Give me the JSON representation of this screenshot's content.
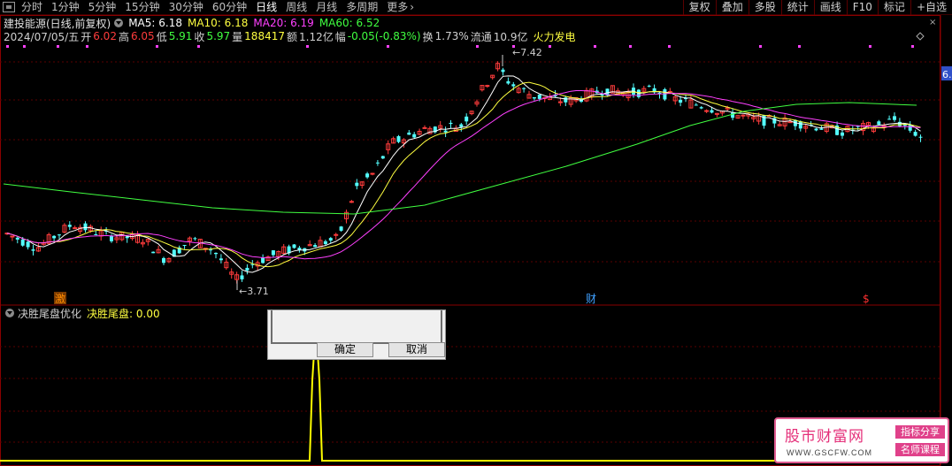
{
  "toolbar": {
    "periods": [
      "分时",
      "1分钟",
      "5分钟",
      "15分钟",
      "30分钟",
      "60分钟",
      "日线",
      "周线",
      "月线",
      "多周期",
      "更多"
    ],
    "active_period": "日线",
    "more_chevron": "›",
    "right_buttons": [
      "复权",
      "叠加",
      "多股",
      "统计",
      "画线",
      "F10",
      "标记",
      "+自选"
    ]
  },
  "stock": {
    "name": "建投能源(日线,前复权)",
    "ma": [
      {
        "label": "MA5: 6.18",
        "color": "#ffffff"
      },
      {
        "label": "MA10: 6.18",
        "color": "#ffff40"
      },
      {
        "label": "MA20: 6.19",
        "color": "#ff40ff"
      },
      {
        "label": "MA60: 6.52",
        "color": "#40ff40"
      }
    ]
  },
  "quote": {
    "date": "2024/07/05/五",
    "open_label": "开",
    "open": "6.02",
    "high_label": "高",
    "high": "6.05",
    "low_label": "低",
    "low": "5.91",
    "close_label": "收",
    "close": "5.97",
    "volume_label": "量",
    "volume": "188417",
    "amount_label": "额",
    "amount": "1.12亿",
    "change_label": "幅",
    "change": "-0.05(-0.83%)",
    "turnover_label": "换",
    "turnover": "1.73%",
    "float_label": "流通",
    "float": "10.9亿",
    "sector": "火力发电"
  },
  "annotations": {
    "high_price": "7.42",
    "low_price": "3.71",
    "price_scale_tag": "6.",
    "markers": [
      {
        "text": "激",
        "color": "#ff8c00"
      },
      {
        "text": "财",
        "color": "#40a0ff"
      },
      {
        "text": "$",
        "color": "#ff3030"
      }
    ]
  },
  "indicator": {
    "name": "决胜尾盘优化",
    "value_label": "决胜尾盘: 0.00"
  },
  "dialog": {
    "ok_label": "确定",
    "cancel_label": "取消"
  },
  "watermark": {
    "title": "股市财富网",
    "url": "WWW.GSCFW.COM",
    "tag1": "指标分享",
    "tag2": "名师课程"
  },
  "colors": {
    "up": "#ff3c3c",
    "down": "#54ffff",
    "ma5": "#ffffff",
    "ma10": "#ffff40",
    "ma20": "#ff40ff",
    "ma60": "#40ff40",
    "frame": "#8a0000",
    "indicator": "#ffff00"
  }
}
